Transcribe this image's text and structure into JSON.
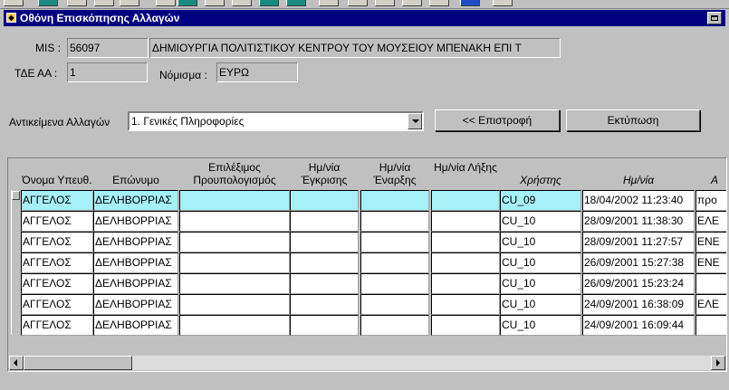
{
  "window": {
    "title": "Οθόνη Επισκόπησης Αλλαγών"
  },
  "header": {
    "mis_label": "MIS :",
    "mis_code": "56097",
    "mis_title": "ΔΗΜΙΟΥΡΓΙΑ ΠΟΛΙΤΙΣΤΙΚΟΥ ΚΕΝΤΡΟΥ ΤΟΥ ΜΟΥΣΕΙΟΥ ΜΠΕΝΑΚΗ ΕΠΙ Τ",
    "tde_label": "ΤΔΕ ΑΑ :",
    "tde_value": "1",
    "currency_label": "Νόμισμα :",
    "currency_value": "ΕΥΡΩ"
  },
  "filter": {
    "label": "Αντικείμενα Αλλαγών",
    "selected": "1. Γενικές Πληροφορίες"
  },
  "buttons": {
    "back": "<< Επιστροφή",
    "print": "Εκτύπωση"
  },
  "table": {
    "headers": {
      "first_name": "Όνομα Υπευθ.",
      "last_name": "Επώνυμο",
      "eligible_budget": "Επιλέξιμος Προυπολογισμός",
      "approval_date": "Ημ/νία Έγκρισης",
      "start_date": "Ημ/νία Έναρξης",
      "end_date": "Ημ/νία Λήξης",
      "user": "Χρήστης",
      "date": "Ημ/νία",
      "desc": "Α"
    },
    "rows": [
      {
        "first_name": "ΑΓΓΕΛΟΣ",
        "last_name": "ΔΕΛΗΒΟΡΡΙΑΣ",
        "user": "CU_09",
        "date": "18/04/2002 11:23:40",
        "desc": "προ"
      },
      {
        "first_name": "ΑΓΓΕΛΟΣ",
        "last_name": "ΔΕΛΗΒΟΡΡΙΑΣ",
        "user": "CU_10",
        "date": "28/09/2001 11:38:30",
        "desc": "ΕΛΕ"
      },
      {
        "first_name": "ΑΓΓΕΛΟΣ",
        "last_name": "ΔΕΛΗΒΟΡΡΙΑΣ",
        "user": "CU_10",
        "date": "28/09/2001 11:27:57",
        "desc": "ΕΝΕ"
      },
      {
        "first_name": "ΑΓΓΕΛΟΣ",
        "last_name": "ΔΕΛΗΒΟΡΡΙΑΣ",
        "user": "CU_10",
        "date": "26/09/2001 15:27:38",
        "desc": "ΕΝΕ"
      },
      {
        "first_name": "ΑΓΓΕΛΟΣ",
        "last_name": "ΔΕΛΗΒΟΡΡΙΑΣ",
        "user": "CU_10",
        "date": "26/09/2001 15:23:24",
        "desc": ""
      },
      {
        "first_name": "ΑΓΓΕΛΟΣ",
        "last_name": "ΔΕΛΗΒΟΡΡΙΑΣ",
        "user": "CU_10",
        "date": "24/09/2001 16:38:09",
        "desc": "ΕΛΕ"
      },
      {
        "first_name": "ΑΓΓΕΛΟΣ",
        "last_name": "ΔΕΛΗΒΟΡΡΙΑΣ",
        "user": "CU_10",
        "date": "24/09/2001 16:09:44",
        "desc": ""
      }
    ]
  }
}
